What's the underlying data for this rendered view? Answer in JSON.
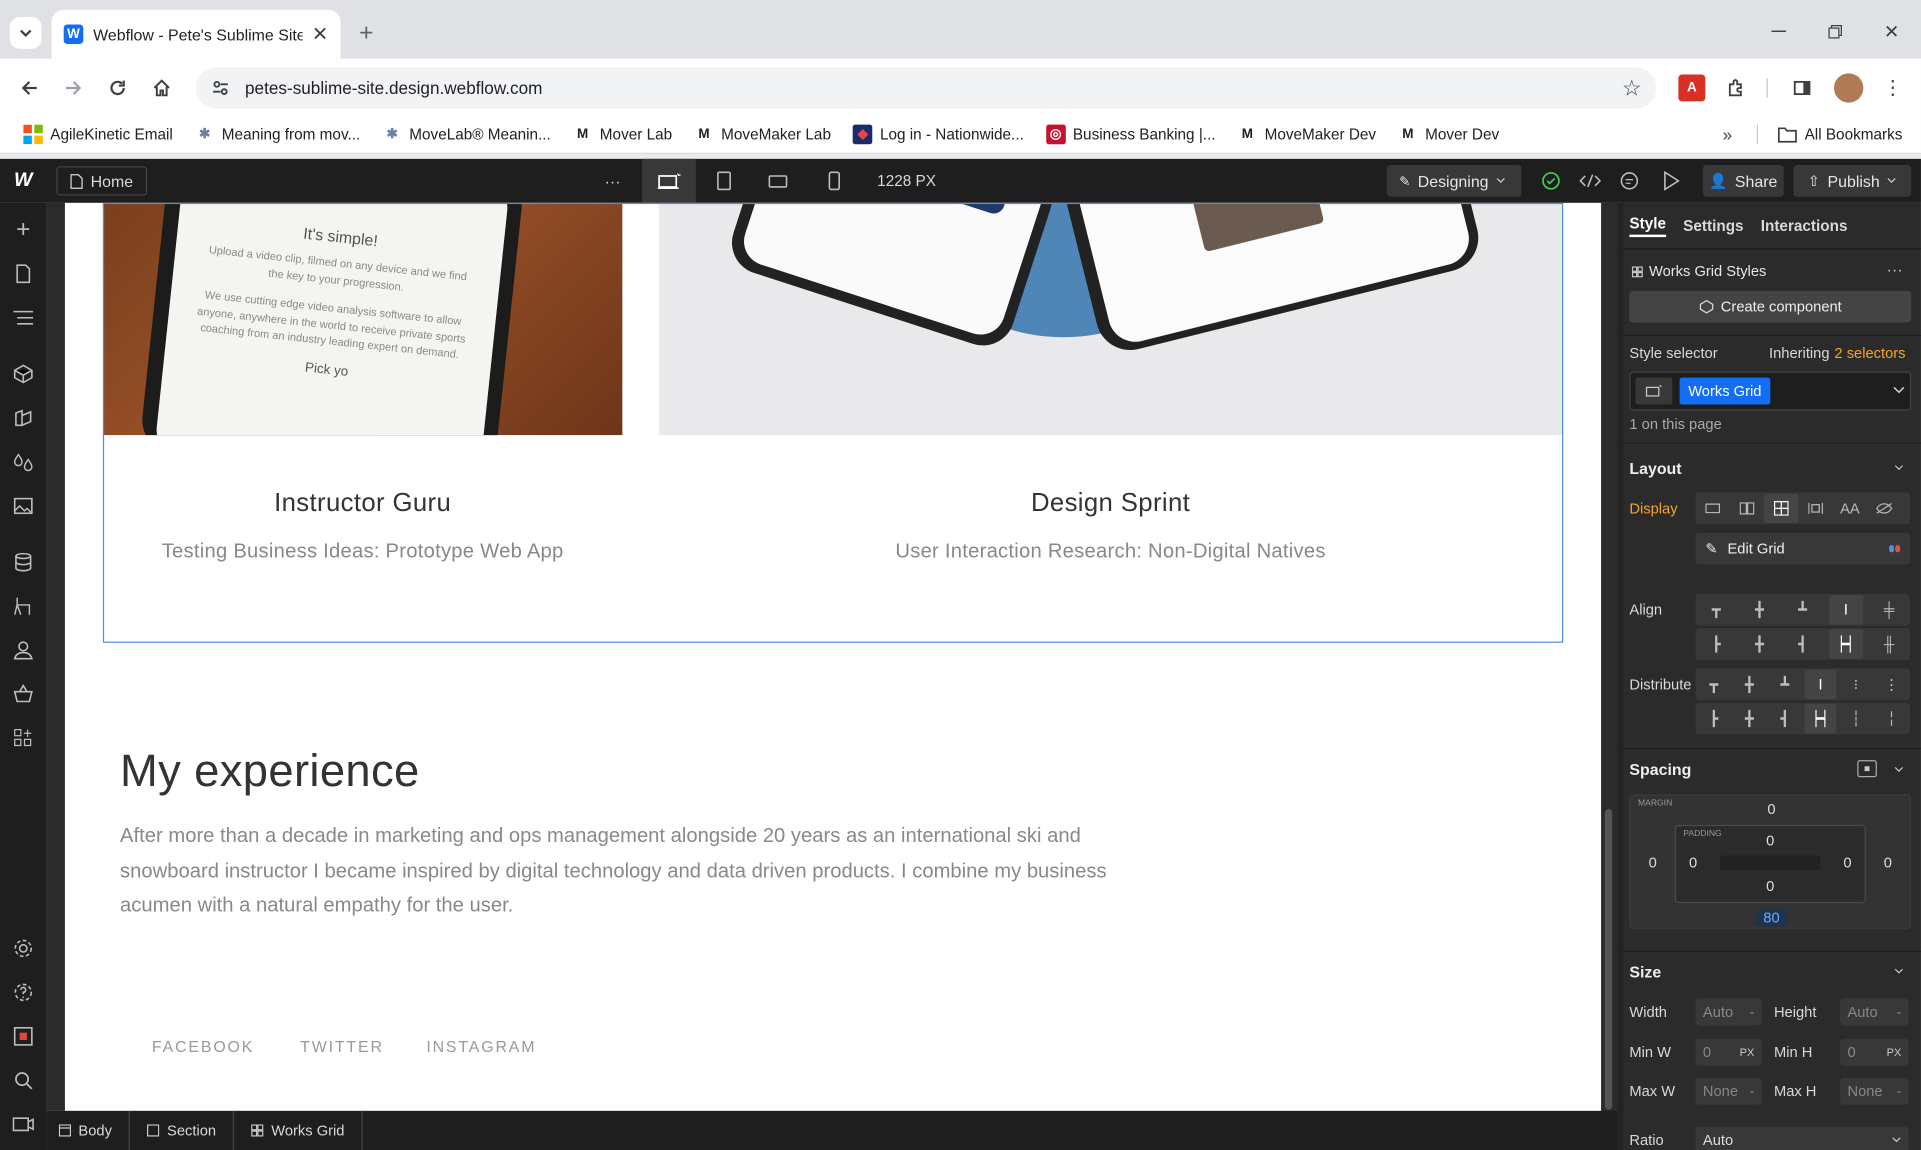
{
  "browser": {
    "tab_title": "Webflow - Pete's Sublime Site",
    "tab_favicon": "W",
    "url": "petes-sublime-site.design.webflow.com",
    "bookmarks": [
      {
        "label": "AgileKinetic Email",
        "icon": "microsoft-icon"
      },
      {
        "label": "Meaning from mov...",
        "icon": "movelab-icon"
      },
      {
        "label": "MoveLab® Meanin...",
        "icon": "movelab-icon"
      },
      {
        "label": "Mover Lab",
        "icon": "m-icon"
      },
      {
        "label": "MoveMaker Lab",
        "icon": "m-icon"
      },
      {
        "label": "Log in - Nationwide...",
        "icon": "nationwide-icon"
      },
      {
        "label": "Business Banking |...",
        "icon": "bank-icon"
      },
      {
        "label": "MoveMaker Dev",
        "icon": "m-icon"
      },
      {
        "label": "Mover Dev",
        "icon": "m-icon"
      }
    ],
    "all_bookmarks": "All Bookmarks"
  },
  "webflow": {
    "page": "Home",
    "more": "···",
    "width_readout": "1228 PX",
    "mode": "Designing",
    "share": "Share",
    "publish": "Publish",
    "breadcrumbs": [
      "Body",
      "Section",
      "Works Grid"
    ]
  },
  "canvas": {
    "phone_text_title": "It's simple!",
    "phone_text_p1": "Upload a video clip, filmed on any device and we find the key to your progression.",
    "phone_text_p2": "We use cutting edge video analysis software to allow anyone, anywhere in the world to receive private sports coaching from an industry leading expert on demand.",
    "phone_text_cta": "Pick yo",
    "works": [
      {
        "title": "Instructor Guru",
        "subtitle": "Testing Business Ideas: Prototype Web App"
      },
      {
        "title": "Design Sprint",
        "subtitle": "User Interaction Research: Non-Digital Natives"
      }
    ],
    "experience_title": "My experience",
    "experience_body": "After more than a decade in marketing and ops management alongside 20 years as an international ski and snowboard instructor I became inspired by digital technology and data driven products. I combine my business acumen with a natural empathy for the user.",
    "social": [
      "FACEBOOK",
      "TWITTER",
      "INSTAGRAM"
    ]
  },
  "panel": {
    "tabs": [
      "Style",
      "Settings",
      "Interactions"
    ],
    "element_styles": "Works Grid Styles",
    "create_component": "Create component",
    "style_selector_label": "Style selector",
    "inheriting_prefix": "Inheriting",
    "inheriting_count": "2 selectors",
    "selector_chip": "Works Grid",
    "on_page": "1 on this page",
    "layout": {
      "title": "Layout",
      "display_label": "Display",
      "display_text_option": "AA",
      "edit_grid": "Edit Grid",
      "align_label": "Align",
      "distribute_label": "Distribute"
    },
    "spacing": {
      "title": "Spacing",
      "margin_label": "MARGIN",
      "padding_label": "PADDING",
      "margin_top": "0",
      "margin_left": "0",
      "margin_right": "0",
      "margin_bottom": "80",
      "padding_top": "0",
      "padding_left": "0",
      "padding_right": "0",
      "padding_bottom": "0"
    },
    "size": {
      "title": "Size",
      "width_label": "Width",
      "width_value": "Auto",
      "height_label": "Height",
      "height_value": "Auto",
      "minw_label": "Min W",
      "minw_value": "0",
      "minh_label": "Min H",
      "minh_value": "0",
      "maxw_label": "Max W",
      "maxw_value": "None",
      "maxh_label": "Max H",
      "maxh_value": "None",
      "unit": "PX",
      "dash": "-",
      "ratio_label": "Ratio",
      "ratio_value": "Auto"
    }
  },
  "colors": {
    "accent": "#146ef5",
    "inheriting": "#f5a623",
    "display_label": "#f5a623"
  }
}
